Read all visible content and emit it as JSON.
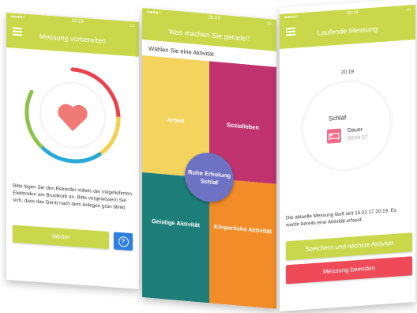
{
  "screen1": {
    "status_time": "20:18",
    "title": "Messung vorbereiten",
    "heart_icon": "heart-icon",
    "instructions": "Bitte legen Sie den Rekorder mittels der mitgelieferten Elektroden am Brustkorb an. Bitte vergewissern Sie sich, dass das Gerät nach dem Anlegen grün blinkt.",
    "next_button": "Weiter",
    "help_button": "?",
    "ring_colors": [
      "#e8434f",
      "#f2d14f",
      "#2aa8d8",
      "#8bc34a"
    ]
  },
  "screen2": {
    "status_time": "20:19",
    "title": "Was machen Sie gerade?",
    "subtitle": "Wählen Sie eine Aktivität",
    "activities": {
      "work": "Arbeit",
      "social": "Sozialleben",
      "mental": "Geistige Aktivität",
      "physical": "Körperliche Aktivität",
      "rest_line1": "Ruhe Erholung",
      "rest_line2": "Schlaf"
    },
    "colors": {
      "work": "#f4d35e",
      "social": "#c0336f",
      "mental": "#1e7f7a",
      "physical": "#f28c28",
      "rest": "#6d72c3"
    }
  },
  "screen3": {
    "status_time": "20:19",
    "title": "Laufende Messung",
    "clock": "20:19",
    "activity_name": "Schlaf",
    "duration_label": "Dauer",
    "duration_value": "00:00:17",
    "bed_icon": "bed-icon",
    "info_text": "Die aktuelle Messung läuft seit 10.01.17 20:19. Es wurde bereits eine Aktivität erfasst.",
    "save_button": "Speichern und nächste Aktivität",
    "stop_button": "Messung beenden",
    "accent": "#c9d84a",
    "stop_color": "#ef4a57"
  }
}
